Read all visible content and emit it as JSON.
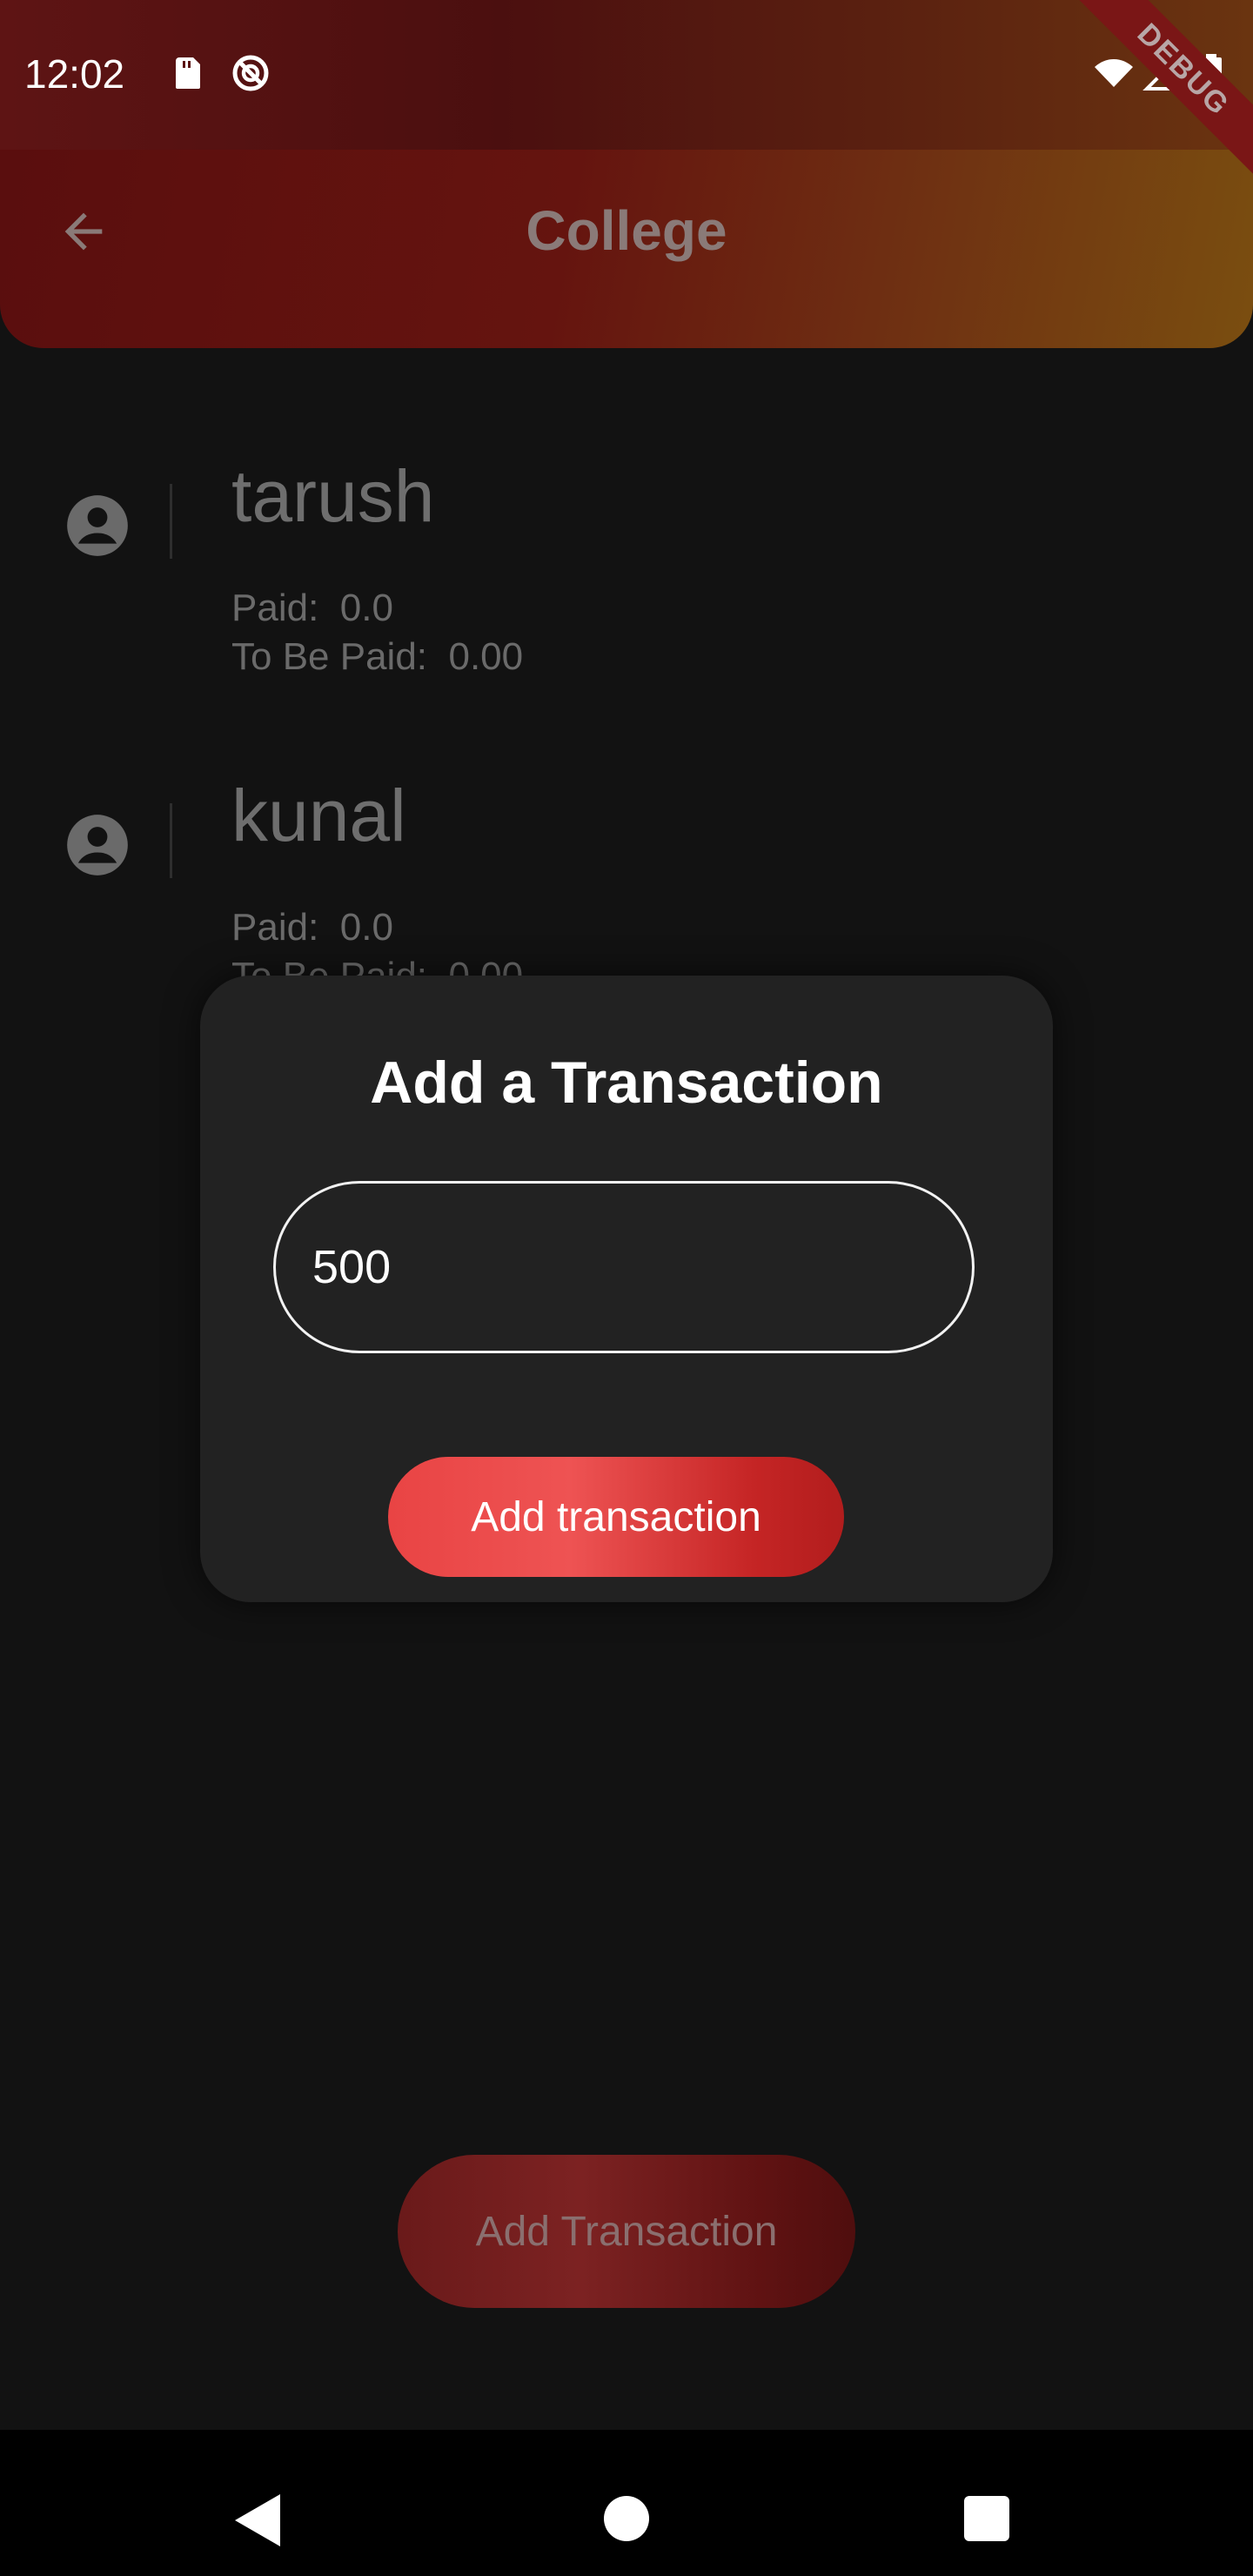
{
  "status_bar": {
    "time": "12:02",
    "icons": [
      "sd-card-icon",
      "do-not-disturb-icon",
      "wifi-icon",
      "signal-icon",
      "battery-icon"
    ]
  },
  "app_bar": {
    "title": "College",
    "back_icon": "arrow-left-icon",
    "debug_label": "DEBUG"
  },
  "members": [
    {
      "name": "tarush",
      "paid_label": "Paid:",
      "paid": "0.0",
      "to_be_paid_label": "To Be Paid:",
      "to_be_paid": "0.00"
    },
    {
      "name": "kunal",
      "paid_label": "Paid:",
      "paid": "0.0",
      "to_be_paid_label": "To Be Paid:",
      "to_be_paid": "0.00"
    }
  ],
  "dialog": {
    "title": "Add a Transaction",
    "amount_value": "500",
    "submit_label": "Add transaction"
  },
  "fab": {
    "label": "Add Transaction"
  },
  "colors": {
    "accent": "#e94444",
    "background": "#121212",
    "dialog": "#222222"
  }
}
